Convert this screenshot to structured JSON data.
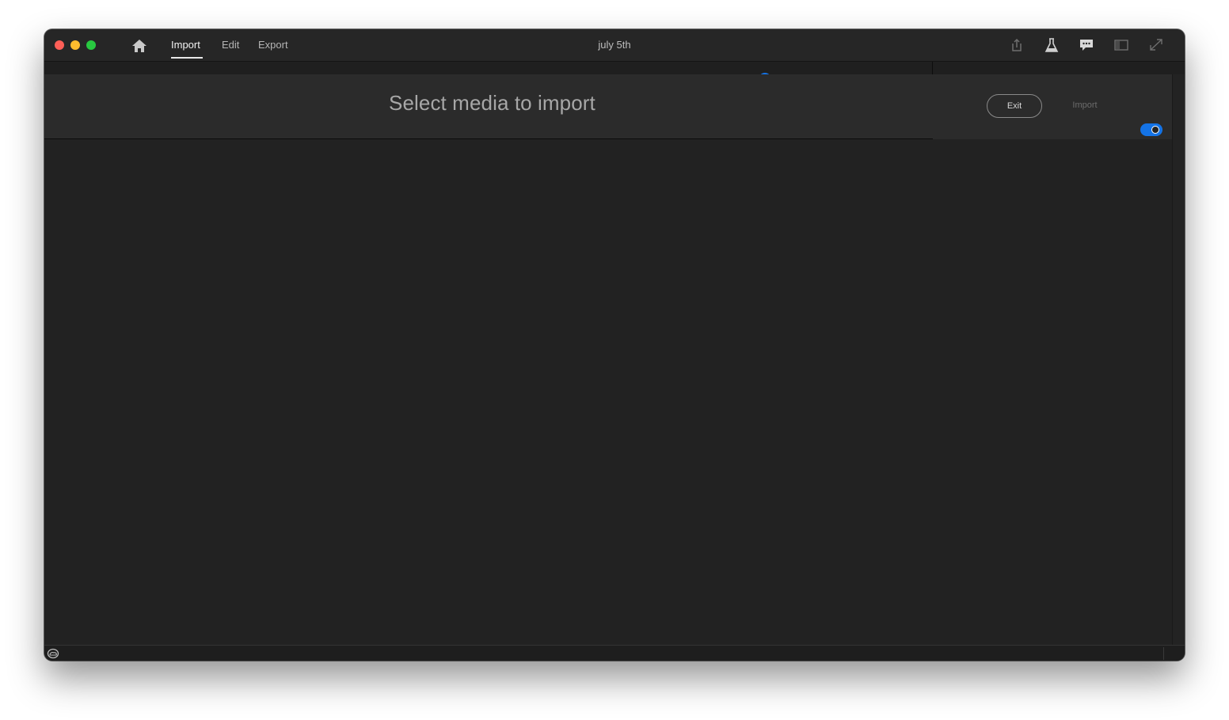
{
  "titlebar": {
    "tabs": [
      {
        "label": "Import",
        "active": true
      },
      {
        "label": "Edit",
        "active": false
      },
      {
        "label": "Export",
        "active": false
      }
    ],
    "document_title": "july 5th",
    "toolbar_icons": [
      "share-icon",
      "flask-icon",
      "feedback-icon",
      "panel-toggle-icon",
      "fullscreen-icon"
    ]
  },
  "import_header": {
    "title": "Select media to import",
    "exit_label": "Exit",
    "import_label": "Import",
    "toggle_on": true
  },
  "colors": {
    "accent": "#1473e6",
    "background": "#222222",
    "header": "#2b2b2b"
  }
}
